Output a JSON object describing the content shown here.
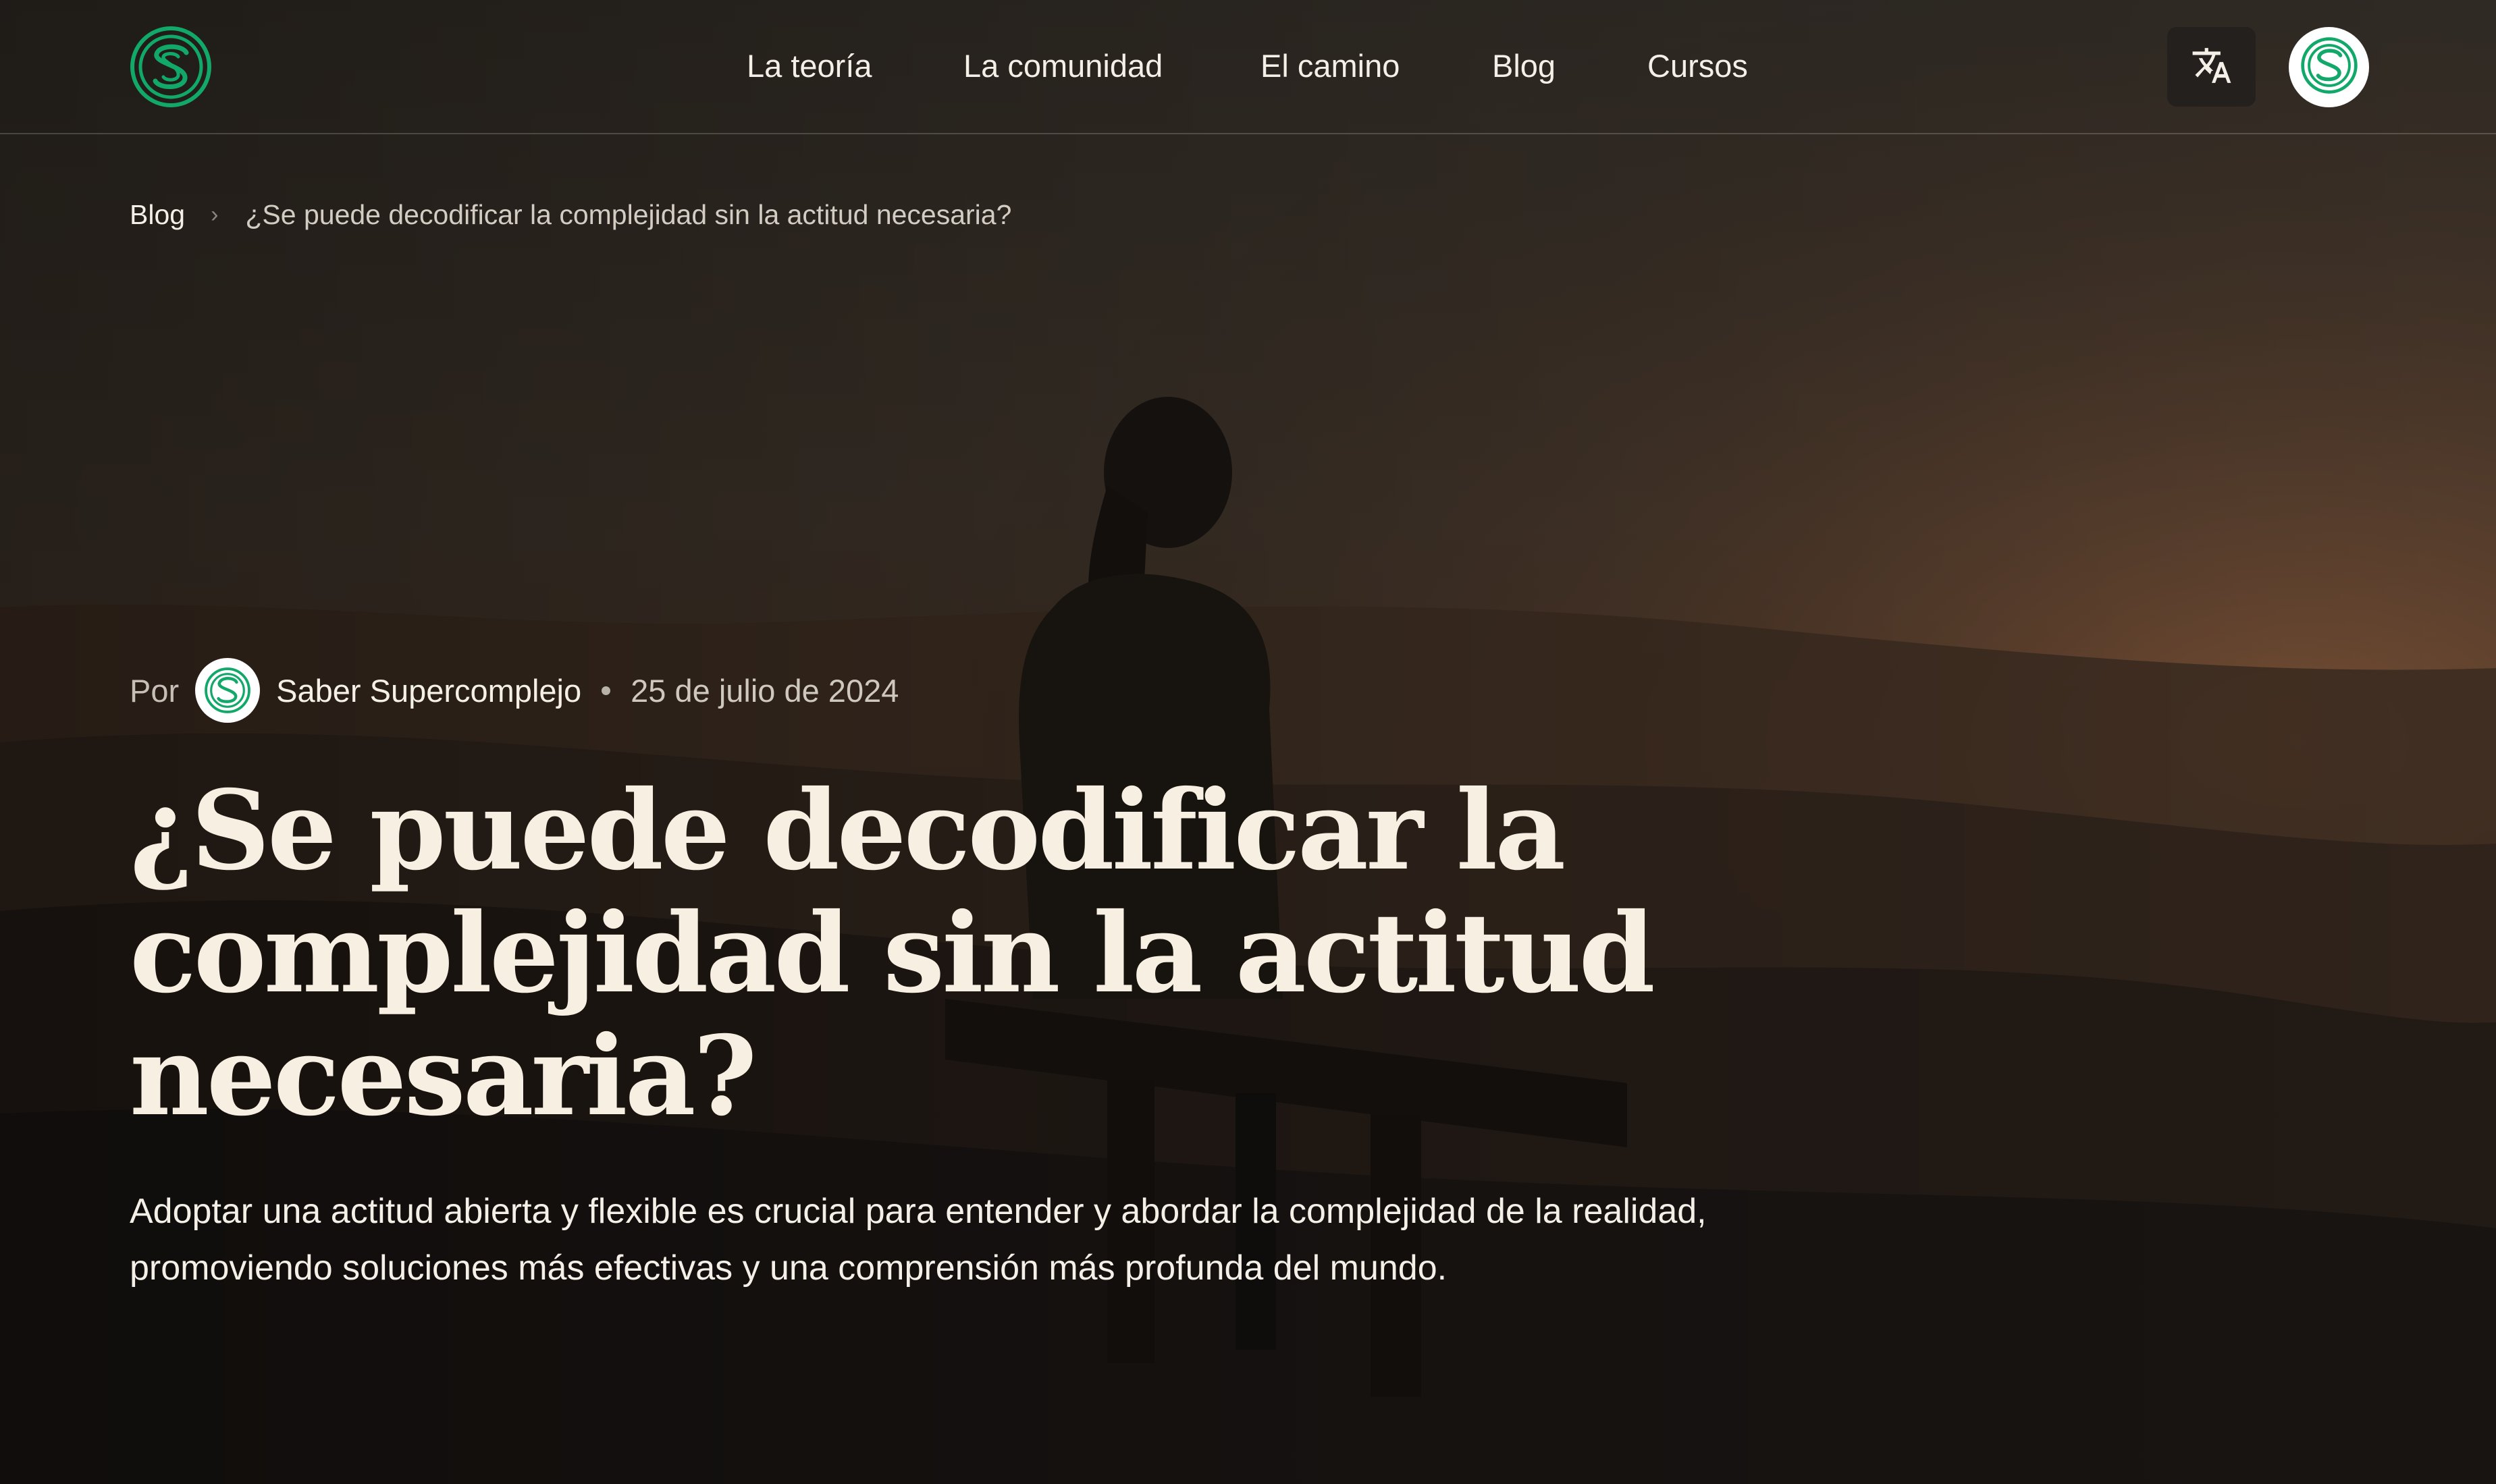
{
  "header": {
    "nav": [
      "La teoría",
      "La comunidad",
      "El camino",
      "Blog",
      "Cursos"
    ]
  },
  "colors": {
    "brand": "#12a86a",
    "background": "#1a1613",
    "title": "#f7efe1"
  },
  "icons": {
    "logo": "supercomplejo-logo-icon",
    "translate": "translate-icon",
    "profile": "user-avatar-icon",
    "breadcrumb_separator": "chevron-right-icon"
  },
  "breadcrumb": {
    "parent": "Blog",
    "separator": "›",
    "current": "¿Se puede decodificar la complejidad sin la actitud necesaria?"
  },
  "article": {
    "by_label": "Por",
    "author": "Saber Supercomplejo",
    "date": "25 de julio de 2024",
    "title": "¿Se puede decodificar la complejidad sin la actitud necesaria?",
    "lead": "Adoptar una actitud abierta y flexible es crucial para entender y abordar la complejidad de la realidad, promoviendo soluciones más efectivas y una comprensión más profunda del mundo."
  }
}
